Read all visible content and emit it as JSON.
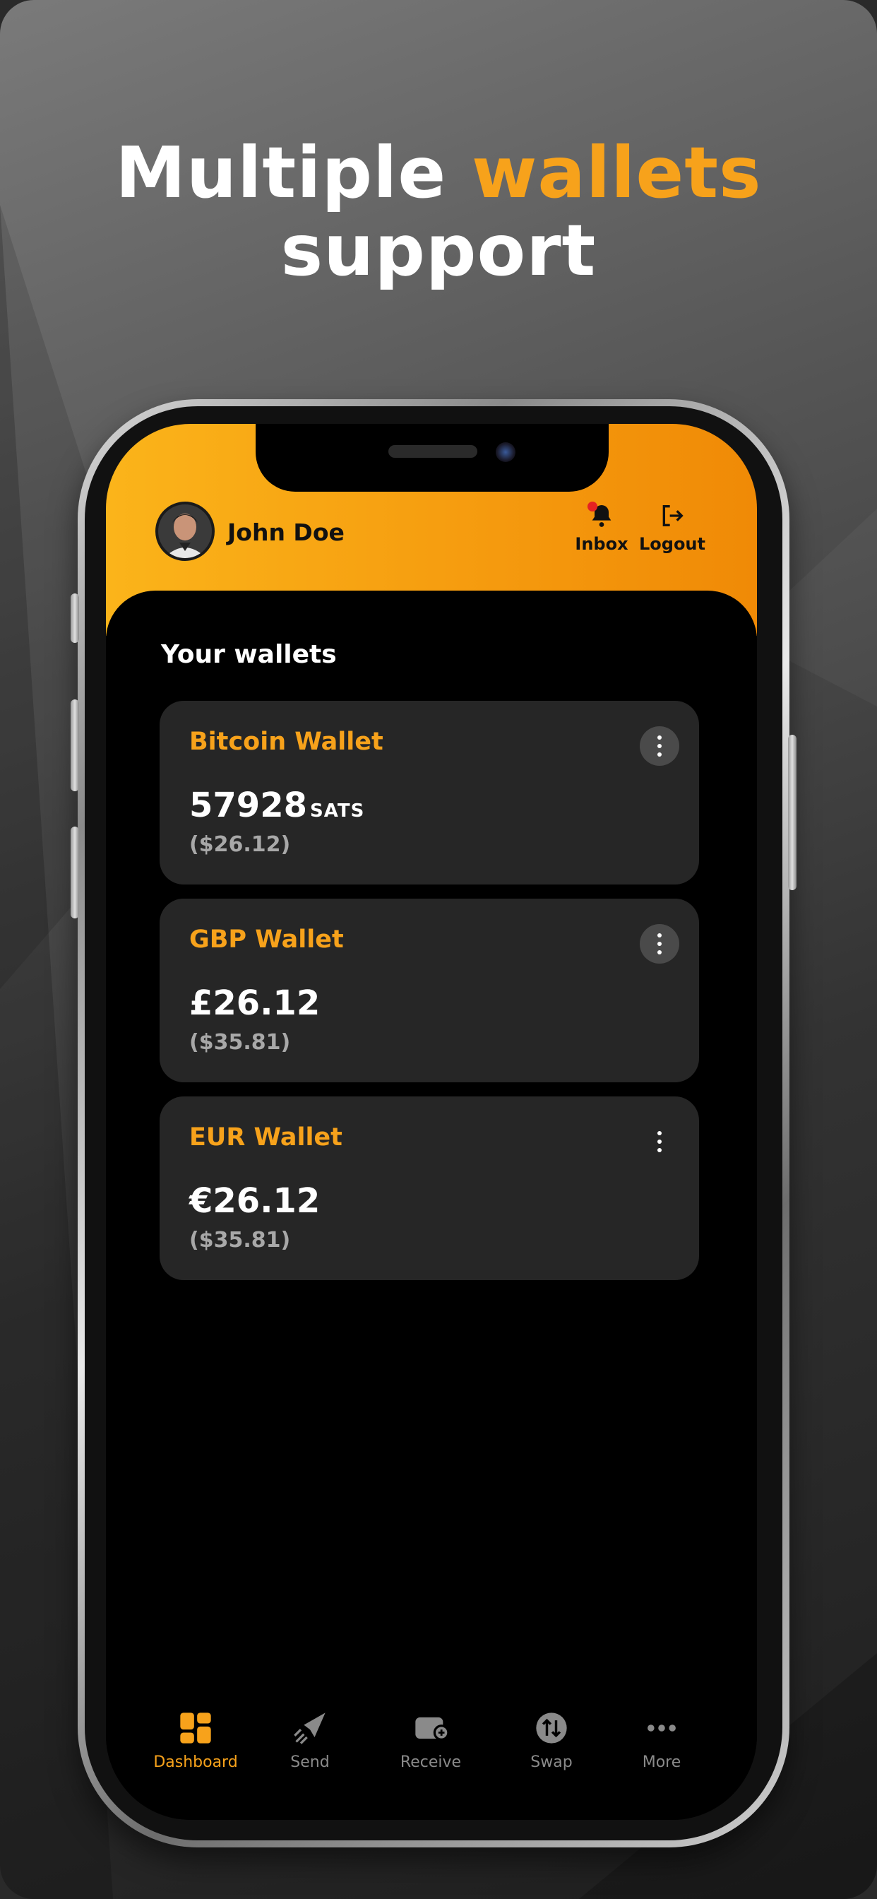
{
  "headline": {
    "line1_plain": "Multiple ",
    "line1_accent": "wallets",
    "line2": "support"
  },
  "user": {
    "name": "John Doe"
  },
  "header_actions": {
    "inbox": "Inbox",
    "logout": "Logout"
  },
  "section_title": "Your wallets",
  "wallets": [
    {
      "name": "Bitcoin Wallet",
      "amount": "57928",
      "unit": "SATS",
      "usd": "($26.12)"
    },
    {
      "name": "GBP Wallet",
      "amount": "£26.12",
      "unit": "",
      "usd": "($35.81)"
    },
    {
      "name": "EUR Wallet",
      "amount": "€26.12",
      "unit": "",
      "usd": "($35.81)"
    }
  ],
  "nav": [
    {
      "label": "Dashboard",
      "icon": "dashboard-icon",
      "active": true
    },
    {
      "label": "Send",
      "icon": "send-icon",
      "active": false
    },
    {
      "label": "Receive",
      "icon": "receive-icon",
      "active": false
    },
    {
      "label": "Swap",
      "icon": "swap-icon",
      "active": false
    },
    {
      "label": "More",
      "icon": "more-icon",
      "active": false
    }
  ],
  "colors": {
    "accent": "#f7a21b",
    "card": "#262626",
    "header_start": "#fbb41a",
    "header_end": "#f08a06"
  }
}
